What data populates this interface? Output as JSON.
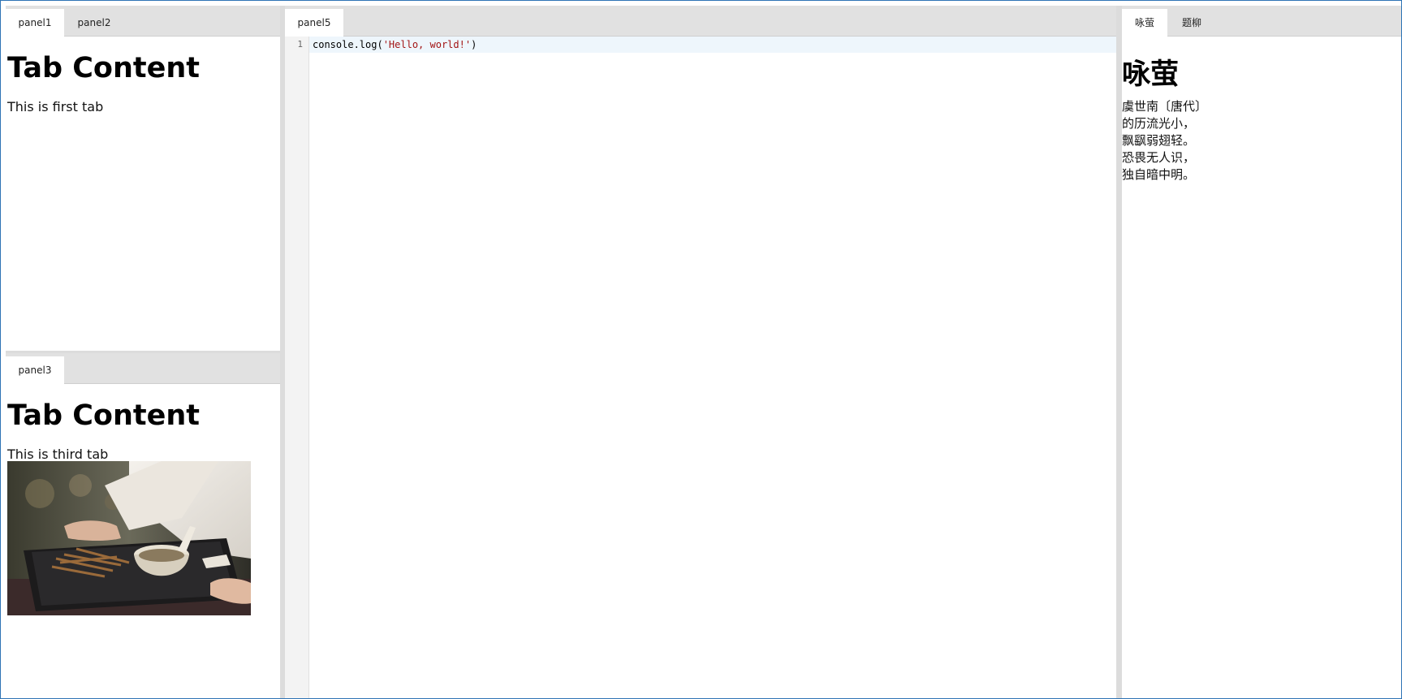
{
  "left_top": {
    "tabs": [
      "panel1",
      "panel2"
    ],
    "heading": "Tab Content",
    "text": "This is first tab"
  },
  "left_bottom": {
    "tabs": [
      "panel3"
    ],
    "heading": "Tab Content",
    "text": "This is third tab",
    "image_icon": "photo-tea-tray"
  },
  "editor": {
    "tabs": [
      "panel5"
    ],
    "line_numbers": [
      "1"
    ],
    "code_prefix": "console.log(",
    "code_string": "'Hello, world!'",
    "code_suffix": ")"
  },
  "right": {
    "tabs": [
      "咏萤",
      "题柳"
    ],
    "poem_title": "咏萤",
    "poem_lines": [
      "虞世南〔唐代〕",
      "的历流光小，",
      "飘飖弱翅轻。",
      "恐畏无人识，",
      "独自暗中明。"
    ]
  },
  "colors": {
    "frame_border": "#2e74b5",
    "tabbar_bg": "#e1e1e1",
    "active_line_bg": "#eef6fc",
    "string_color": "#a31515"
  }
}
